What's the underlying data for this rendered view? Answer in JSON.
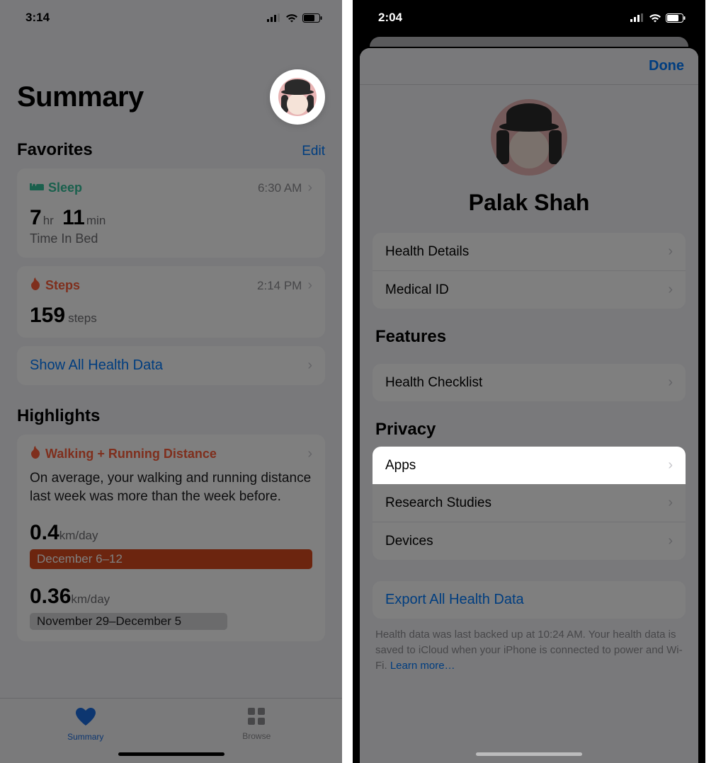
{
  "left": {
    "status": {
      "time": "3:14"
    },
    "title": "Summary",
    "favorites_header": "Favorites",
    "edit": "Edit",
    "sleep": {
      "name": "Sleep",
      "time": "6:30 AM",
      "hours": "7",
      "hours_unit": "hr",
      "minutes": "11",
      "minutes_unit": "min",
      "sub": "Time In Bed"
    },
    "steps": {
      "name": "Steps",
      "time": "2:14 PM",
      "value": "159",
      "unit": "steps"
    },
    "show_all": "Show All Health Data",
    "highlights_header": "Highlights",
    "highlight": {
      "name": "Walking + Running Distance",
      "body": "On average, your walking and running distance last week was more than the week before.",
      "val1": "0.4",
      "unit1": "km/day",
      "range1": "December 6–12",
      "val2": "0.36",
      "unit2": "km/day",
      "range2": "November 29–December 5"
    },
    "tabs": {
      "summary": "Summary",
      "browse": "Browse"
    }
  },
  "right": {
    "status": {
      "time": "2:04"
    },
    "done": "Done",
    "profile_name": "Palak Shah",
    "rows": {
      "health_details": "Health Details",
      "medical_id": "Medical ID",
      "health_checklist": "Health Checklist",
      "apps": "Apps",
      "research": "Research Studies",
      "devices": "Devices",
      "export": "Export All Health Data"
    },
    "headers": {
      "features": "Features",
      "privacy": "Privacy"
    },
    "footer": "Health data was last backed up at 10:24 AM. Your health data is saved to iCloud when your iPhone is connected to power and Wi-Fi. ",
    "learn_more": "Learn more…"
  }
}
